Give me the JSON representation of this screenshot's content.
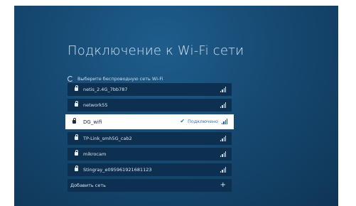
{
  "title": "Подключение к Wi-Fi сети",
  "subtitle": "Выберите беспроводную сеть Wi-Fi",
  "networks": [
    {
      "ssid": "netis_2.4G_7bb787",
      "secured": true,
      "connected": false
    },
    {
      "ssid": "network55",
      "secured": true,
      "connected": false
    },
    {
      "ssid": "DG_wifi",
      "secured": true,
      "connected": true,
      "status": "Подключено"
    },
    {
      "ssid": "TP-Link_smh5G_cab2",
      "secured": true,
      "connected": false
    },
    {
      "ssid": "mikrocam",
      "secured": true,
      "connected": false
    },
    {
      "ssid": "Stingray_e09596192168112З",
      "secured": true,
      "connected": false
    }
  ],
  "add_network": {
    "label": "Добавить сеть",
    "icon": "plus-icon"
  },
  "colors": {
    "background": "#164a73",
    "row": "#0d3050",
    "selected_row": "#ffffff",
    "accent": "#2f6fc4"
  }
}
